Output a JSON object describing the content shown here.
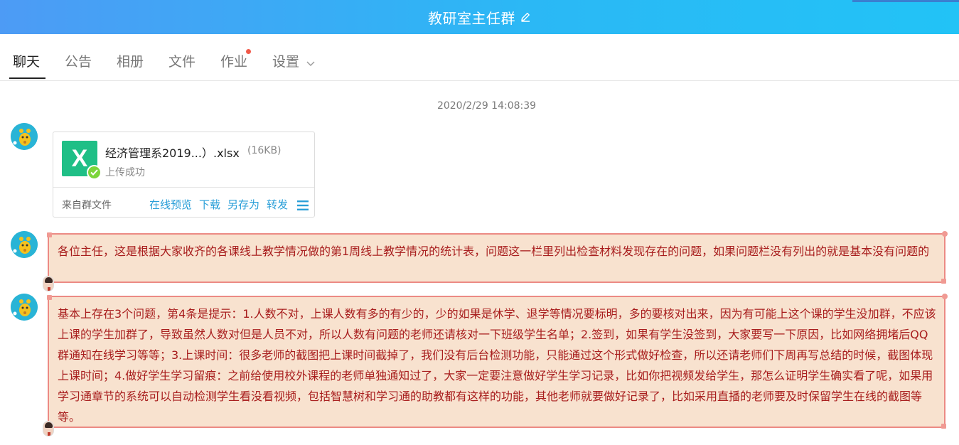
{
  "header": {
    "title": "教研室主任群",
    "edit_icon": "pencil-icon"
  },
  "tabs": [
    {
      "label": "聊天",
      "active": true
    },
    {
      "label": "公告"
    },
    {
      "label": "相册"
    },
    {
      "label": "文件"
    },
    {
      "label": "作业",
      "badge_dot": true
    },
    {
      "label": "设置",
      "dropdown": true
    }
  ],
  "chat": {
    "timestamp": "2020/2/29 14:08:39",
    "file_message": {
      "file_icon": "excel-file-icon",
      "file_name": "经济管理系2019...）.xlsx",
      "file_size": "(16KB)",
      "status": "上传成功",
      "source": "来自群文件",
      "actions": [
        "在线预览",
        "下载",
        "另存为",
        "转发"
      ]
    },
    "messages": [
      {
        "text": "各位主任，这是根据大家收齐的各课线上教学情况做的第1周线上教学情况的统计表，问题这一栏里列出检查材料发现存在的问题，如果问题栏没有列出的就是基本没有问题的"
      },
      {
        "text": "基本上存在3个问题，第4条是提示：1.人数不对，上课人数有多的有少的，少的如果是休学、退学等情况要标明，多的要核对出来，因为有可能上这个课的学生没加群，不应该上课的学生加群了，导致虽然人数对但是人员不对，所以人数有问题的老师还请核对一下班级学生名单；2.签到，如果有学生没签到，大家要写一下原因，比如网络拥堵后QQ群通知在线学习等等；3.上课时间：很多老师的截图把上课时间截掉了，我们没有后台检测功能，只能通过这个形式做好检查，所以还请老师们下周再写总结的时候，截图体现上课时间；4.做好学生学习留痕：之前给使用校外课程的老师单独通知过了，大家一定要注意做好学生学习记录，比如你把视频发给学生，那怎么证明学生确实看了呢，如果用学习通章节的系统可以自动检测学生看没看视频，包括智慧树和学习通的助教都有这样的功能，其他老师就要做好记录了，比如采用直播的老师要及时保留学生在线的截图等等。"
      }
    ]
  },
  "colors": {
    "header_gradient_start": "#4d9bf5",
    "header_gradient_end": "#22c3f6",
    "bubble_bg": "#f8e2cf",
    "bubble_border": "#ec8a84",
    "bubble_text": "#a81d1d",
    "link": "#2a9fd8"
  }
}
